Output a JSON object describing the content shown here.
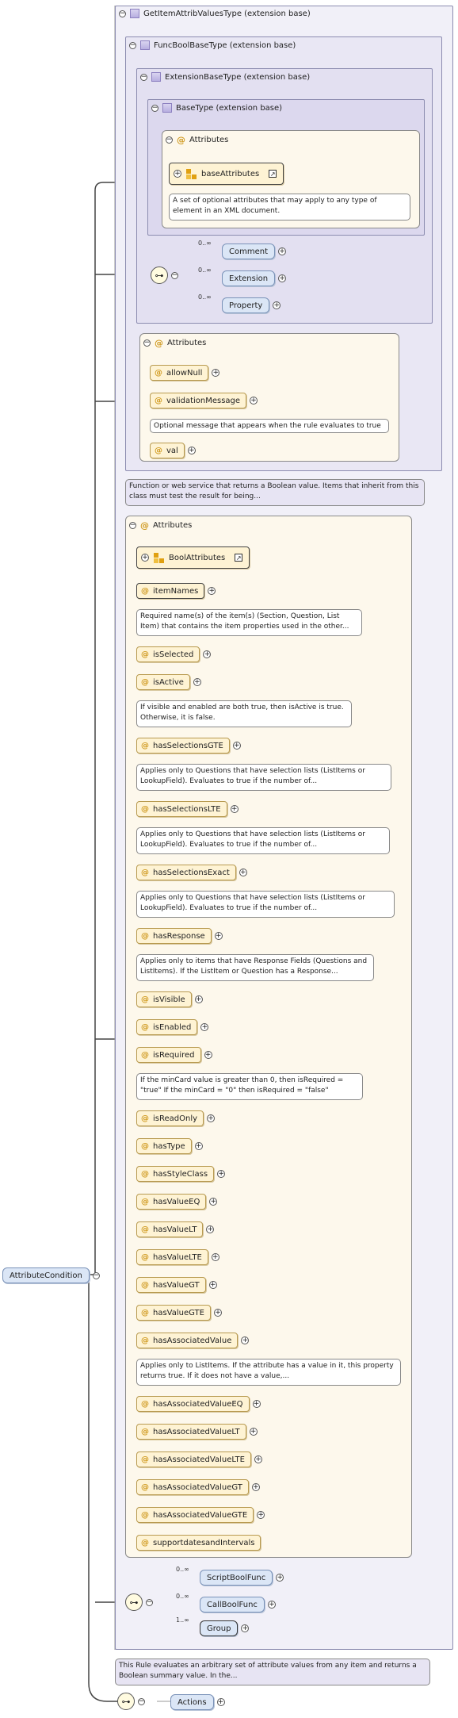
{
  "regions": {
    "getitem_title": "GetItemAttribValuesType (extension base)",
    "funcbool_title": "FuncBoolBaseType (extension base)",
    "extbase_title": "ExtensionBaseType (extension base)",
    "basetype_title": "BaseType (extension base)",
    "attributes_label": "Attributes"
  },
  "base_attributes": {
    "label": "baseAttributes",
    "note": "A set of optional attributes that may apply to any type of element in an XML document."
  },
  "ext_sequence": [
    {
      "label": "Comment",
      "card": "0..∞"
    },
    {
      "label": "Extension",
      "card": "0..∞"
    },
    {
      "label": "Property",
      "card": "0..∞"
    }
  ],
  "func_attributes": {
    "allow_null": "allowNull",
    "validation_message": "validationMessage",
    "validation_note": "Optional message that appears when the rule evaluates to true",
    "val": "val"
  },
  "funcbool_note": "Function or web service that returns a Boolean value. Items that inherit from this class must test the result for being...",
  "bool_attributes_label": "BoolAttributes",
  "attributes": [
    {
      "label": "itemNames",
      "note": "Required name(s) of the item(s) (Section, Question, List Item) that contains the item properties used in the other..."
    },
    {
      "label": "isSelected"
    },
    {
      "label": "isActive",
      "note": "If visible and enabled are both true, then isActive is true. Otherwise, it is false."
    },
    {
      "label": "hasSelectionsGTE",
      "note": "Applies only to Questions that have selection lists (ListItems or LookupField). Evaluates to true if the number of..."
    },
    {
      "label": "hasSelectionsLTE",
      "note": "Applies only to Questions that have selection lists (ListItems or LookupField). Evaluates to true if the number of..."
    },
    {
      "label": "hasSelectionsExact",
      "note": "Applies only to Questions that have selection lists (ListItems or LookupField). Evaluates to true if the number of..."
    },
    {
      "label": "hasResponse",
      "note": "Applies only to items that have Response Fields (Questions and ListItems). If the ListItem or Question has a Response..."
    },
    {
      "label": "isVisible"
    },
    {
      "label": "isEnabled"
    },
    {
      "label": "isRequired",
      "note": "If the minCard value is greater than 0, then isRequired = \"true\" If the minCard = \"0\" then isRequired = \"false\""
    },
    {
      "label": "isReadOnly"
    },
    {
      "label": "hasType"
    },
    {
      "label": "hasStyleClass"
    },
    {
      "label": "hasValueEQ"
    },
    {
      "label": "hasValueLT"
    },
    {
      "label": "hasValueLTE"
    },
    {
      "label": "hasValueGT"
    },
    {
      "label": "hasValueGTE"
    },
    {
      "label": "hasAssociatedValue",
      "note": "Applies only to ListItems. If the attribute has a value in it, this property returns true. If it does not have a value,..."
    },
    {
      "label": "hasAssociatedValueEQ"
    },
    {
      "label": "hasAssociatedValueLT"
    },
    {
      "label": "hasAssociatedValueLTE"
    },
    {
      "label": "hasAssociatedValueGT"
    },
    {
      "label": "hasAssociatedValueGTE"
    },
    {
      "label": "supportdatesandIntervals"
    }
  ],
  "func_sequence": [
    {
      "label": "ScriptBoolFunc",
      "card": "0..∞"
    },
    {
      "label": "CallBoolFunc",
      "card": "0..∞"
    },
    {
      "label": "Group",
      "card": "1..∞"
    }
  ],
  "getitem_note": "This Rule evaluates an arbitrary set of attribute values from any item and returns a Boolean summary value. In the...",
  "root": {
    "label": "AttributeCondition"
  },
  "actions": {
    "label": "Actions"
  }
}
